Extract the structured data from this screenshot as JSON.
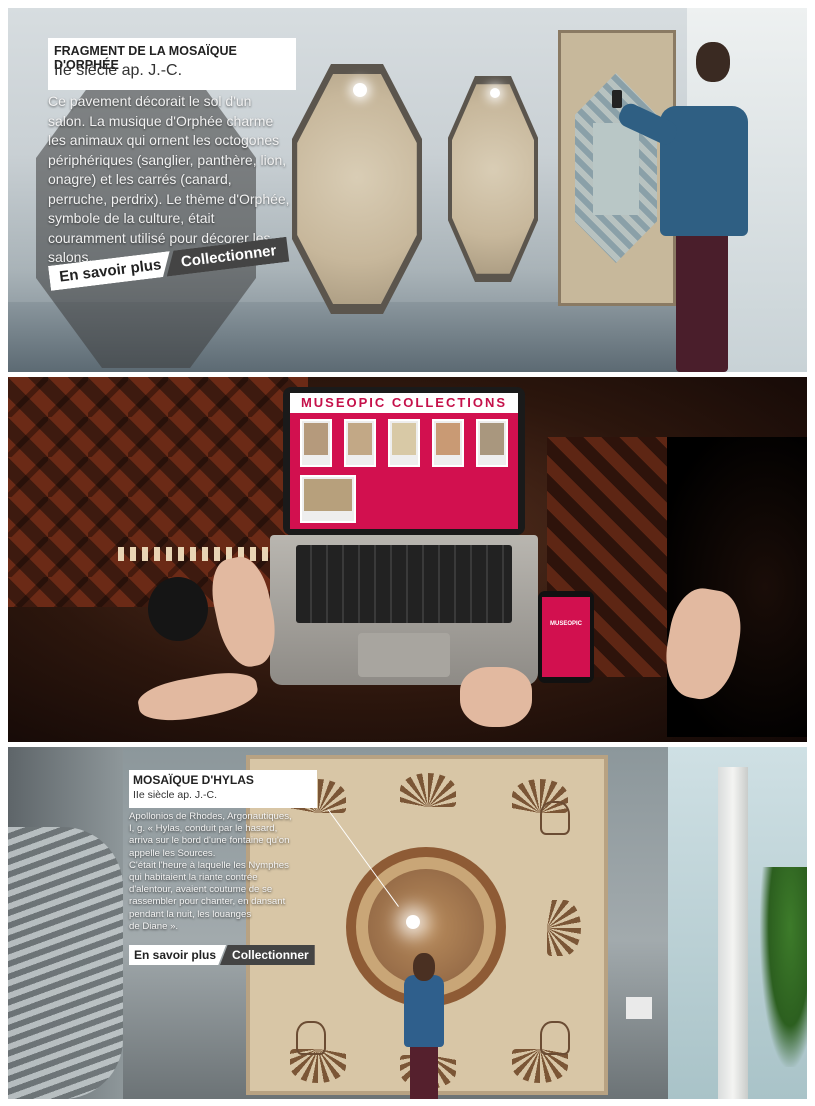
{
  "panel1": {
    "title": "FRAGMENT DE LA MOSAÏQUE D'ORPHÉE",
    "subtitle": "IIe siècle ap. J.-C.",
    "body_lines": [
      "Ce pavement décorait le sol d'un",
      "salon. La musique d'Orphée charme",
      "les animaux qui ornent les octogones",
      "périphériques (sanglier, panthère, lion,",
      "onagre) et les carrés (canard,",
      "perruche, perdrix). Le thème d'Orphée,",
      "symbole de la culture, était",
      "couramment utilisé pour décorer les",
      "salons."
    ],
    "learn_more_label": "En savoir plus",
    "collect_label": "Collectionner"
  },
  "panel2": {
    "app_title": "MUSEOPIC COLLECTIONS",
    "phone_label": "MUSEOPIC",
    "accent_color": "#d2104f",
    "thumbnail_count": 6
  },
  "panel3": {
    "title": "MOSAÏQUE D'HYLAS",
    "subtitle": "IIe siècle ap. J.-C.",
    "body_lines": [
      "Apollonios de Rhodes, Argonautiques,",
      "I, g. « Hylas, conduit par le hasard,",
      "arriva sur le bord d'une fontaine qu'on",
      "appelle les Sources.",
      "C'était l'heure à laquelle les Nymphes",
      "qui habitaient la riante contrée",
      "d'alentour, avaient coutume de se",
      "rassembler pour chanter, en dansant",
      "pendant la nuit, les louanges",
      "de Diane »."
    ],
    "learn_more_label": "En savoir plus",
    "collect_label": "Collectionner"
  }
}
